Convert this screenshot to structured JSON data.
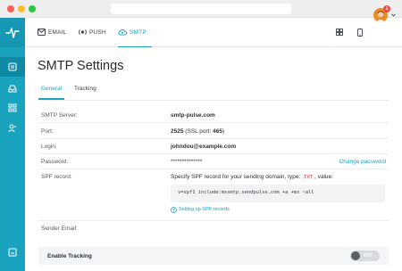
{
  "window": {
    "traffic_lights": {
      "close": "#ff5f57",
      "minimize": "#febc2e",
      "maximize": "#28c840"
    }
  },
  "colors": {
    "accent": "#19a3bf",
    "sidebar": "#19a3bf",
    "badge": "#e84c3d"
  },
  "sidebar": {
    "logo_icon": "pulse-logo-icon",
    "items": [
      {
        "icon": "dashboard-icon",
        "active": true
      },
      {
        "icon": "inbox-icon",
        "active": false
      },
      {
        "icon": "automation-icon",
        "active": false
      },
      {
        "icon": "contacts-icon",
        "active": false
      },
      {
        "icon": "logout-icon",
        "active": false
      }
    ]
  },
  "topnav": {
    "tabs": [
      {
        "label": "EMAIL",
        "icon": "envelope-icon",
        "active": false
      },
      {
        "label": "PUSH",
        "icon": "push-icon",
        "active": false
      },
      {
        "label": "SMTP",
        "icon": "cloud-icon",
        "active": true
      }
    ],
    "right_icons": [
      "apps-grid-icon",
      "mobile-icon"
    ],
    "notification_count": "1"
  },
  "page": {
    "title": "SMTP Settings",
    "subtabs": [
      {
        "label": "General",
        "active": true
      },
      {
        "label": "Tracking",
        "active": false
      }
    ]
  },
  "settings": {
    "smtp_server": {
      "label": "SMTP Server:",
      "value": "smtp-pulse.com"
    },
    "port": {
      "label": "Port:",
      "value": "2525",
      "ssl_text": " (SSL port: ",
      "ssl_port": "465",
      "close": ")"
    },
    "login": {
      "label": "Login:",
      "value": "johndou@example.com"
    },
    "password": {
      "label": "Password:",
      "value": "**************",
      "change_link": "Change password"
    },
    "spf": {
      "label": "SPF record:",
      "desc_before": "Specify SPF record for your sending domain, type: ",
      "type_tag": "TXT",
      "desc_after": ", value:",
      "code": "v=spf1 include:mxsmtp.sendpulse.com +a +mx ~all",
      "help_link": "Setting up SPF records"
    },
    "sender_email": {
      "label": "Sender Email:",
      "value": ""
    }
  },
  "tracking": {
    "label": "Enable Tracking",
    "toggle_state": "OFF"
  }
}
